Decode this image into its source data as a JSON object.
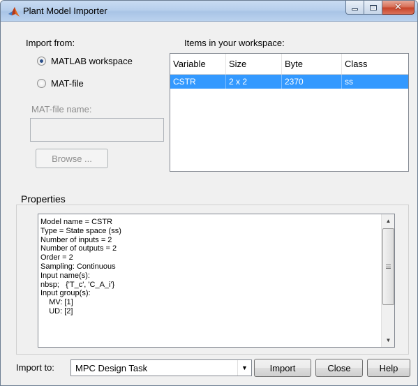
{
  "window": {
    "title": "Plant Model Importer"
  },
  "import_from": {
    "label": "Import from:",
    "options": [
      {
        "label": "MATLAB workspace",
        "selected": true
      },
      {
        "label": "MAT-file",
        "selected": false
      }
    ],
    "matfile_label": "MAT-file name:",
    "matfile_value": "",
    "browse_label": "Browse ..."
  },
  "workspace": {
    "label": "Items in your workspace:",
    "columns": [
      "Variable",
      "Size",
      "Byte",
      "Class"
    ],
    "rows": [
      {
        "variable": "CSTR",
        "size": "2 x 2",
        "byte": "2370",
        "class": "ss",
        "selected": true
      }
    ]
  },
  "properties": {
    "label": "Properties",
    "lines": [
      "Model name = CSTR",
      "Type = State space (ss)",
      "Number of inputs = 2",
      "Number of outputs = 2",
      "Order = 2",
      "Sampling: Continuous",
      "Input name(s):",
      "nbsp;   {'T_c', 'C_A_i'}",
      "Input group(s):",
      "    MV: [1]",
      "    UD: [2]"
    ]
  },
  "bottom": {
    "import_to_label": "Import to:",
    "import_to_value": "MPC Design Task",
    "import_button": "Import",
    "close_button": "Close",
    "help_button": "Help"
  },
  "colors": {
    "selection": "#3399ff",
    "window_bg": "#f0f0f0"
  }
}
